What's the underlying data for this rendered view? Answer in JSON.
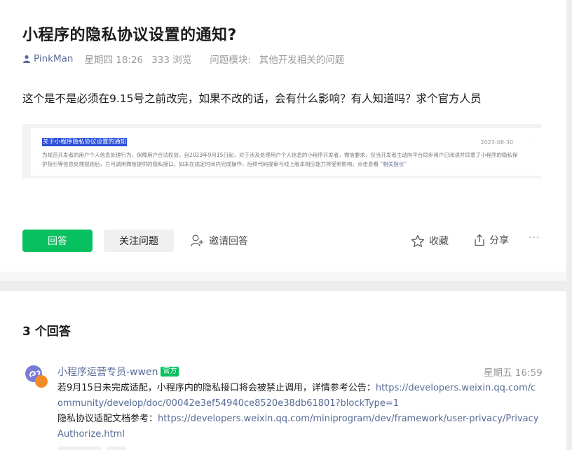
{
  "question": {
    "title": "小程序的隐私协议设置的通知?",
    "author": "PinkMan",
    "time": "星期四 18:26",
    "views": "333 浏览",
    "module_label": "问题模块:",
    "module_value": "其他开发相关的问题",
    "body": "这个是不是必须在9.15号之前改完，如果不改的话，会有什么影响？有人知道吗？求个官方人员",
    "screenshot": {
      "title": "关于小程序隐私协议设置的通知",
      "date": "2023-08-30",
      "sep": "·",
      "text": "为规范开发者的用户个人信息处理行为，保障用户合法权益，自2023年9月15日起，对于涉及处理用户个人信息的小程序开发者，微信要求，仅当开发者主动向平台同步用户已阅读并同意了小程序的隐私保护指引等信息处理规则后，方可调用微信提供的隐私接口。如未在规定时间内完成操作，后续代码提审与线上版本相应能力将受到影响。点击查看",
      "link": "“相关指引”"
    }
  },
  "actions": {
    "answer": "回答",
    "follow": "关注问题",
    "invite": "邀请回答",
    "favorite": "收藏",
    "share": "分享",
    "more": "···"
  },
  "answers": {
    "count_label": "3 个回答",
    "items": [
      {
        "author": "小程序运营专员-wwen",
        "badge": "官方",
        "time": "星期五 16:59",
        "line1_text": "若9月15日未完成适配，小程序内的隐私接口将会被禁止调用，详情参考公告：",
        "line1_link": "https://developers.weixin.qq.com/community/develop/doc/00042e3ef54940ce8520e38db61801?blockType=1",
        "line2_text": "隐私协议适配文档参考：",
        "line2_link": "https://developers.weixin.qq.com/miniprogram/dev/framework/user-privacy/PrivacyAuthorize.html"
      }
    ]
  },
  "colors": {
    "accent_green": "#07c160",
    "link_blue": "#576b95",
    "screenshot_highlight": "#2a4fd6"
  }
}
